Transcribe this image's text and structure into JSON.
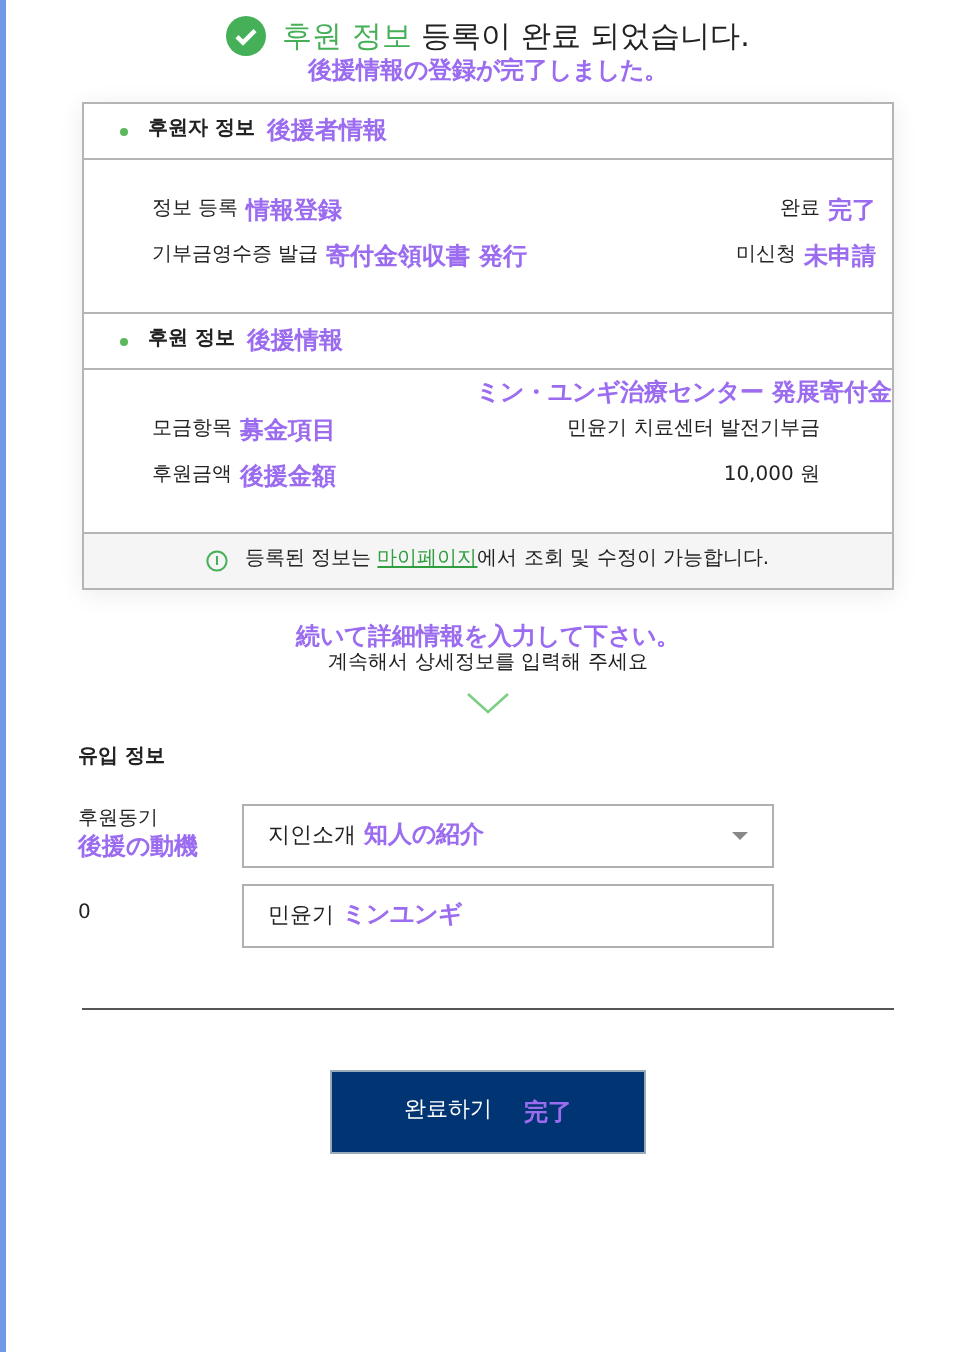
{
  "header": {
    "title_highlight": "후원 정보",
    "title_rest": "등록이 완료 되었습니다.",
    "note": "後援情報の登録が完了しました。"
  },
  "sections": [
    {
      "title": "후원자 정보",
      "note": "後援者情報",
      "rows": [
        {
          "label": "정보 등록",
          "label_note": "情報登録",
          "value": "완료",
          "value_note": "完了"
        },
        {
          "label": "기부금영수증 발급",
          "label_note": "寄付金領収書 発行",
          "value": "미신청",
          "value_note": "未申請"
        }
      ]
    },
    {
      "title": "후원 정보",
      "note": "後援情報",
      "top_note": "ミン・ユンギ治療センター 発展寄付金",
      "rows": [
        {
          "label": "모금항목",
          "label_note": "募金項目",
          "value": "민윤기 치료센터 발전기부금"
        },
        {
          "label": "후원금액",
          "label_note": "後援金額",
          "value": "10,000 원"
        }
      ]
    }
  ],
  "notice": {
    "before": "등록된 정보는 ",
    "link": "마이페이지",
    "after": "에서 조회 및 수정이 가능합니다."
  },
  "next": {
    "note": "続いて詳細情報を入力して下さい。",
    "text": "계속해서 상세정보를 입력해 주세요"
  },
  "form": {
    "title": "유입 정보",
    "fields": [
      {
        "kind": "select",
        "label": "후원동기",
        "label_note": "後援の動機",
        "value": "지인소개",
        "value_note": "知人の紹介"
      },
      {
        "kind": "text",
        "label": "0",
        "value": "민윤기",
        "value_note": "ミンユンギ"
      }
    ]
  },
  "button": {
    "label": "완료하기",
    "note": "完了"
  }
}
